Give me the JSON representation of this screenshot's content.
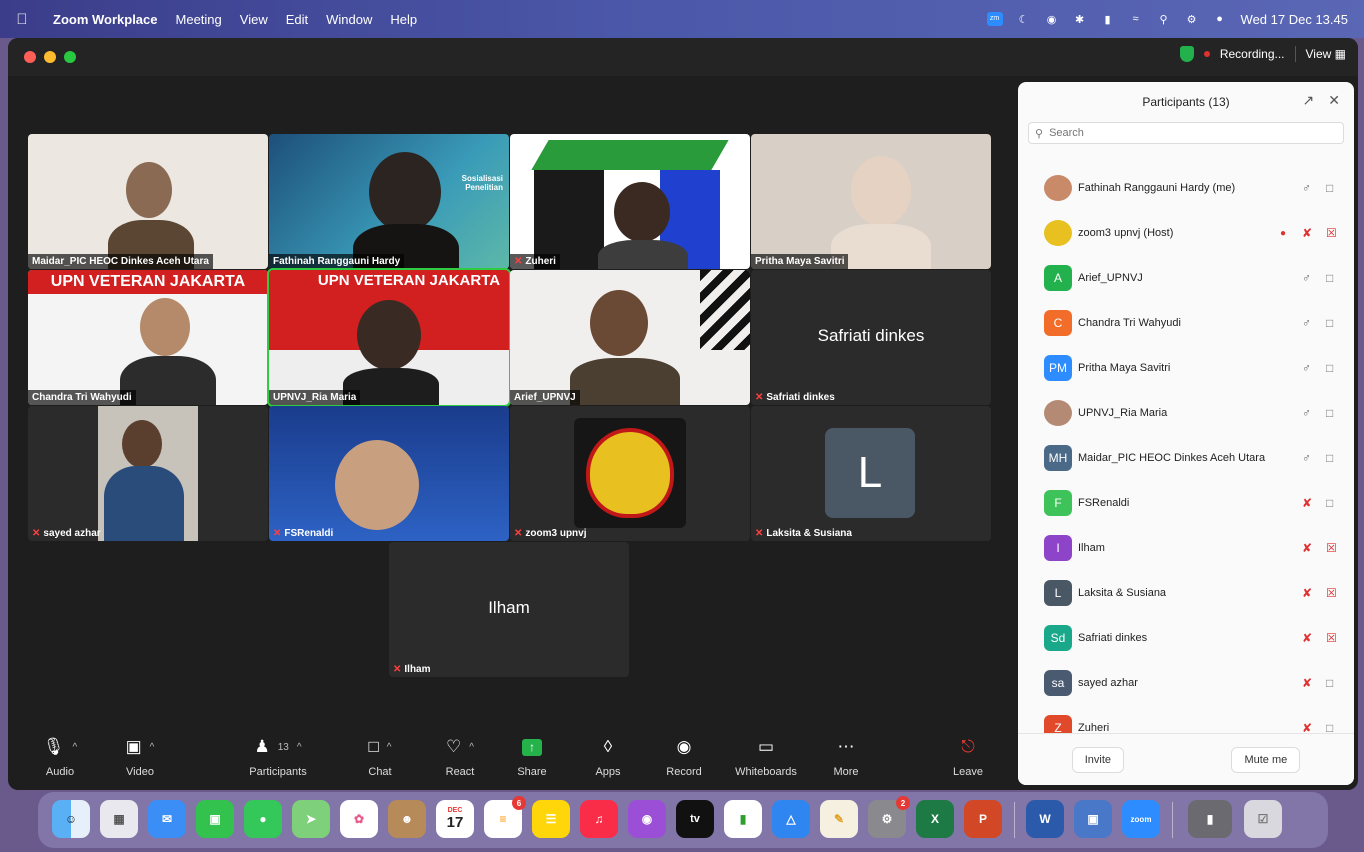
{
  "menubar": {
    "app_name": "Zoom Workplace",
    "menus": [
      "Meeting",
      "View",
      "Edit",
      "Window",
      "Help"
    ],
    "datetime": "Wed 17 Dec  13.45"
  },
  "titlebar": {
    "recording": "Recording...",
    "view": "View"
  },
  "tiles": [
    {
      "name": "Maidar_PIC HEOC Dinkes Aceh Utara",
      "muted": false
    },
    {
      "name": "Fathinah Ranggauni Hardy",
      "muted": false,
      "bg_text": "Sosialisasi Penelitian"
    },
    {
      "name": "Zuheri",
      "muted": true
    },
    {
      "name": "Pritha Maya Savitri",
      "muted": false
    },
    {
      "name": "Chandra Tri Wahyudi",
      "muted": false,
      "bg_text": "UPN VETERAN JAKARTA"
    },
    {
      "name": "UPNVJ_Ria Maria",
      "muted": false,
      "bg_text": "UPN VETERAN JAKARTA"
    },
    {
      "name": "Arief_UPNVJ",
      "muted": false
    },
    {
      "name": "Safriati dinkes",
      "muted": true,
      "display_name": "Safriati dinkes"
    },
    {
      "name": "sayed azhar",
      "muted": true
    },
    {
      "name": "FSRenaldi",
      "muted": true
    },
    {
      "name": "zoom3 upnvj",
      "muted": true
    },
    {
      "name": "Laksita & Susiana",
      "muted": true,
      "letter": "L"
    },
    {
      "name": "Ilham",
      "muted": true,
      "display_name": "Ilham"
    }
  ],
  "toolbar": {
    "audio": "Audio",
    "video": "Video",
    "participants": "Participants",
    "participants_count": "13",
    "chat": "Chat",
    "react": "React",
    "share": "Share",
    "apps": "Apps",
    "record": "Record",
    "whiteboards": "Whiteboards",
    "more": "More",
    "leave": "Leave"
  },
  "panel": {
    "title": "Participants (13)",
    "search_placeholder": "Search",
    "invite": "Invite",
    "mute_me": "Mute me",
    "participants": [
      {
        "name": "Fathinah Ranggauni Hardy (me)",
        "initials": "",
        "color": "#c98a6a",
        "mic_off": false,
        "cam_off": false
      },
      {
        "name": "zoom3 upnvj (Host)",
        "initials": "",
        "color": "#e8c020",
        "mic_off": true,
        "cam_off": true
      },
      {
        "name": "Arief_UPNVJ",
        "initials": "A",
        "color": "#22b14c",
        "mic_off": false,
        "cam_off": false
      },
      {
        "name": "Chandra Tri Wahyudi",
        "initials": "C",
        "color": "#f26d2a",
        "mic_off": false,
        "cam_off": false
      },
      {
        "name": "Pritha Maya Savitri",
        "initials": "PM",
        "color": "#2d8cff",
        "mic_off": false,
        "cam_off": false
      },
      {
        "name": "UPNVJ_Ria Maria",
        "initials": "",
        "color": "#b58a74",
        "mic_off": false,
        "cam_off": false
      },
      {
        "name": "Maidar_PIC HEOC Dinkes Aceh Utara",
        "initials": "MH",
        "color": "#4a6a88",
        "mic_off": false,
        "cam_off": false
      },
      {
        "name": "FSRenaldi",
        "initials": "F",
        "color": "#3ec35a",
        "mic_off": true,
        "cam_off": false
      },
      {
        "name": "Ilham",
        "initials": "I",
        "color": "#8e44c8",
        "mic_off": true,
        "cam_off": true
      },
      {
        "name": "Laksita & Susiana",
        "initials": "L",
        "color": "#4a5866",
        "mic_off": true,
        "cam_off": true
      },
      {
        "name": "Safriati dinkes",
        "initials": "Sd",
        "color": "#1aa88a",
        "mic_off": true,
        "cam_off": true
      },
      {
        "name": "sayed azhar",
        "initials": "sa",
        "color": "#4a5a70",
        "mic_off": true,
        "cam_off": false
      },
      {
        "name": "Zuheri",
        "initials": "Z",
        "color": "#e04a2a",
        "mic_off": true,
        "cam_off": false
      }
    ]
  },
  "dock": {
    "calendar_month": "DEC",
    "calendar_day": "17",
    "reminders_badge": "6",
    "settings_badge": "2",
    "tv_label": "tv",
    "zoom_label": "zoom"
  }
}
